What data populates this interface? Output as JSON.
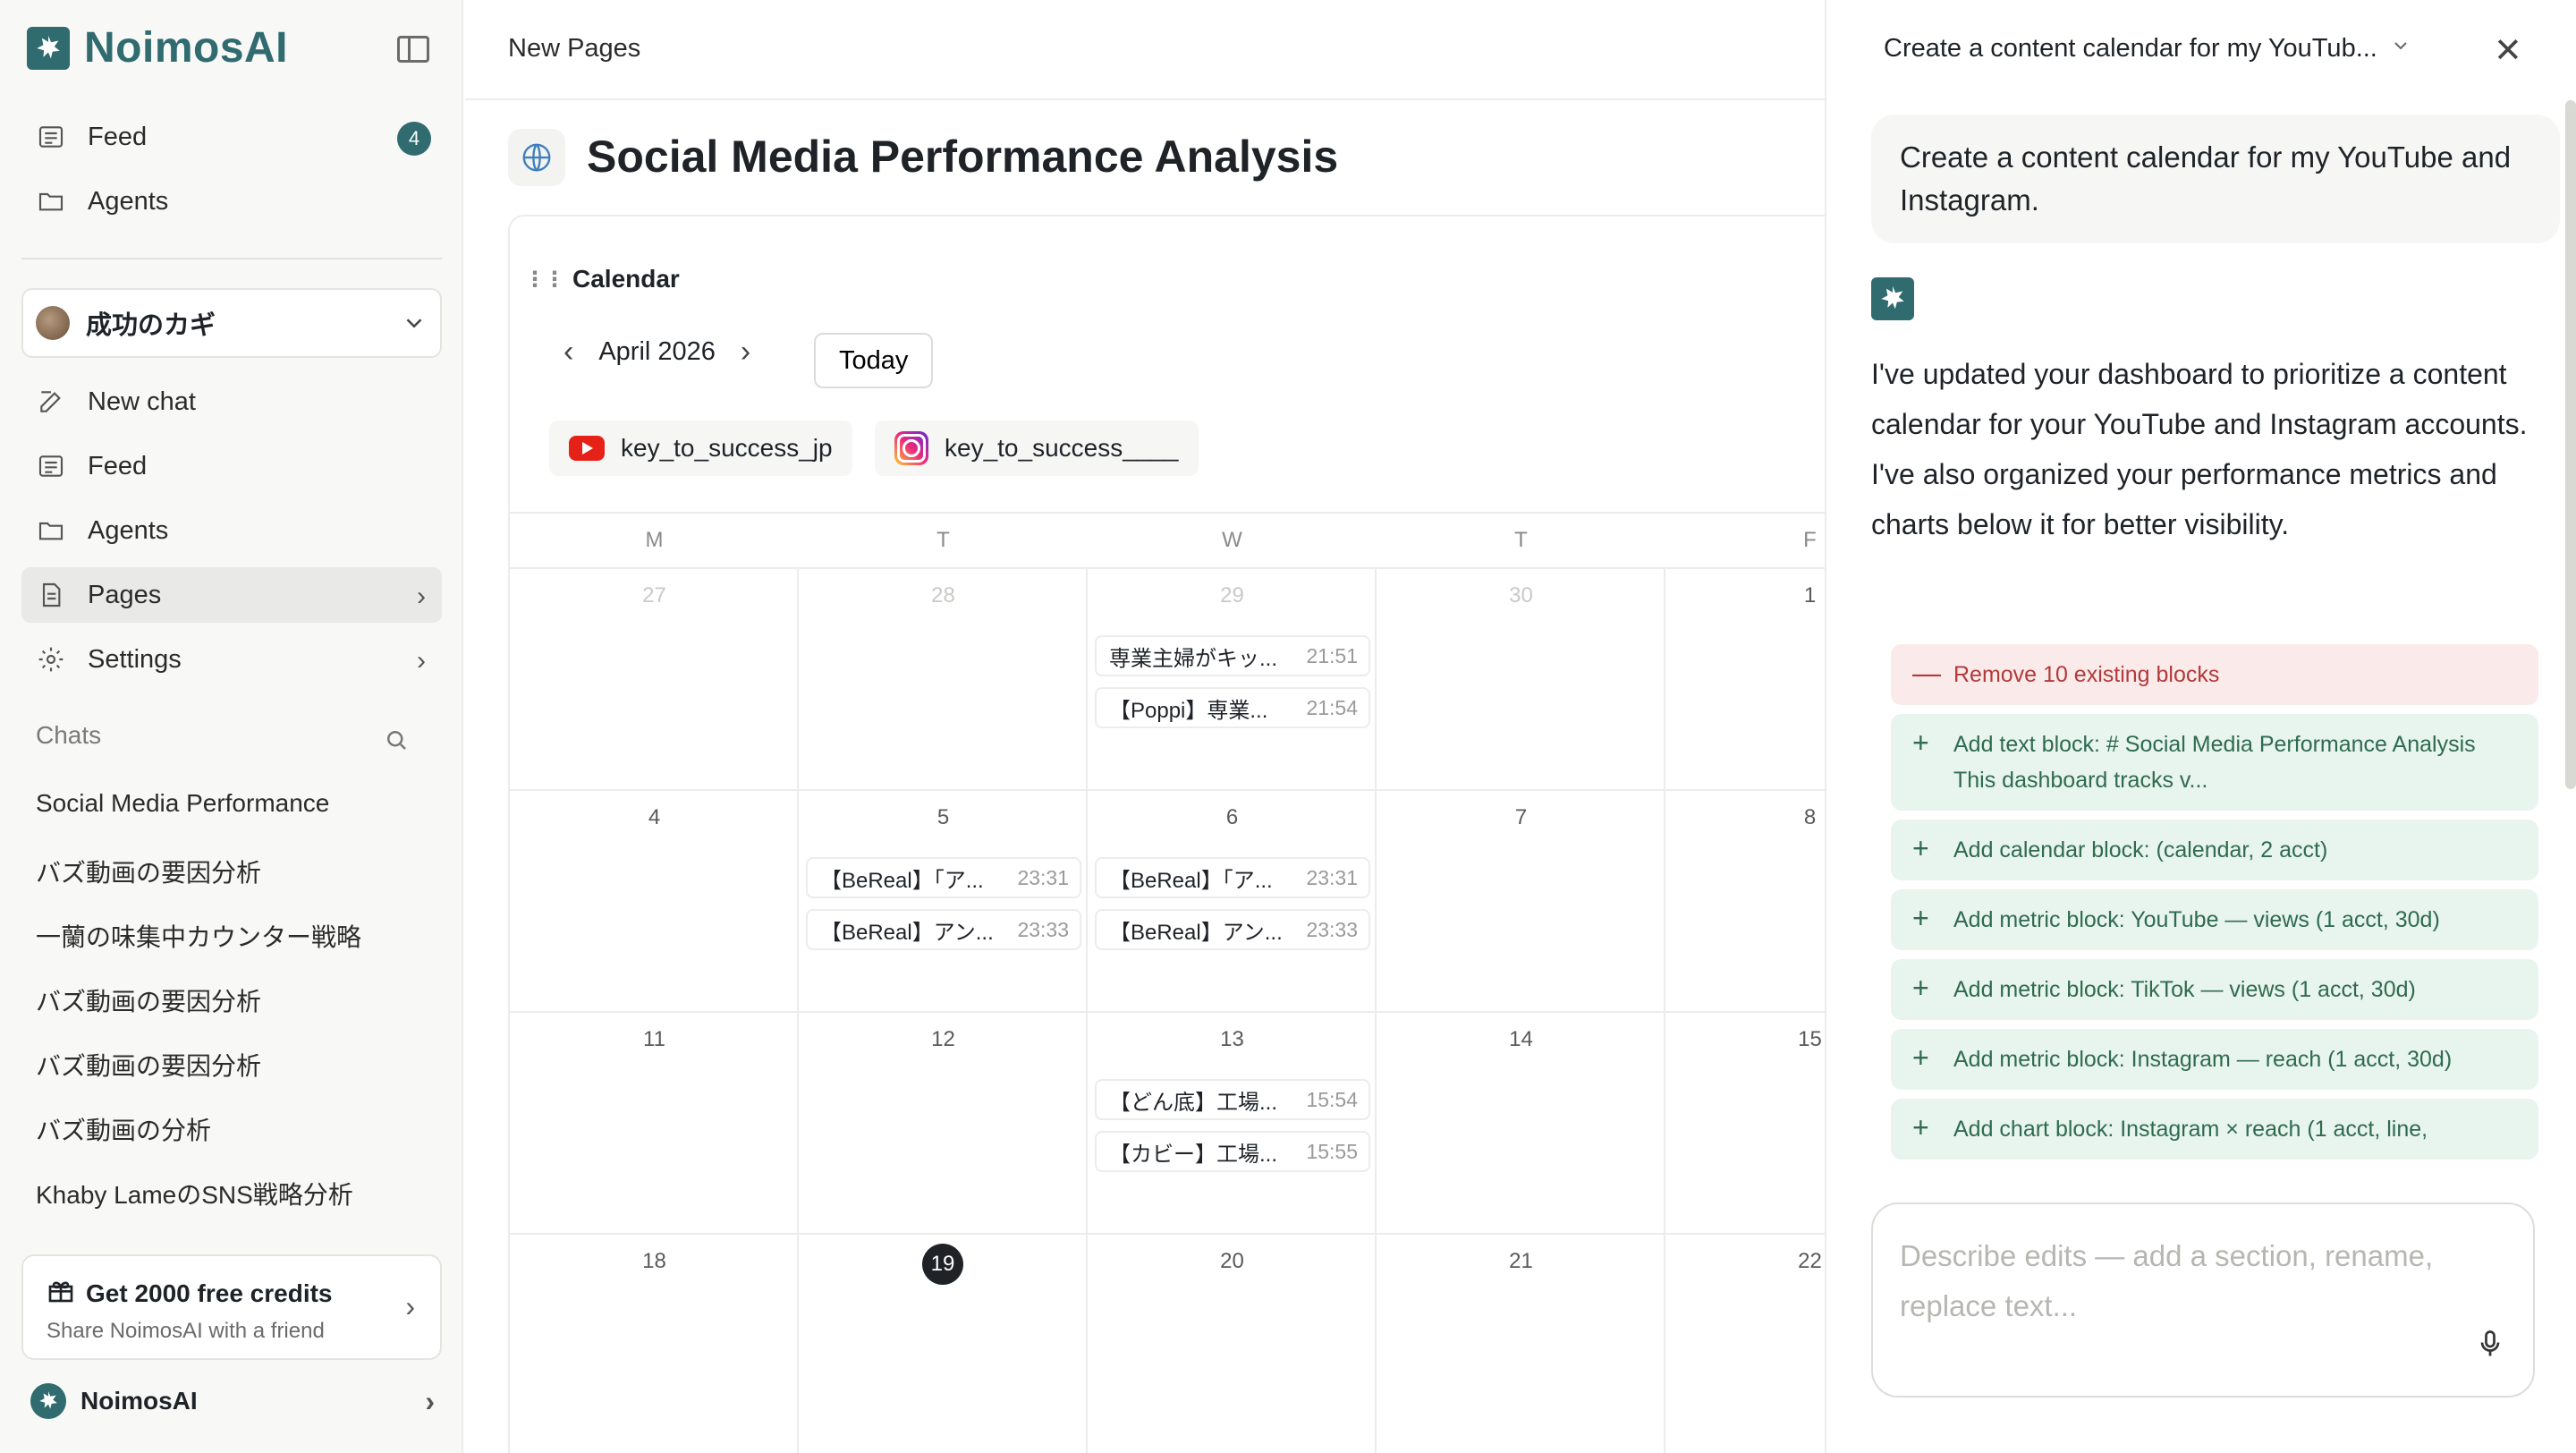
{
  "brand": {
    "name": "NoimosAI"
  },
  "sidebar": {
    "top_items": [
      {
        "label": "Feed",
        "badge": "4"
      },
      {
        "label": "Agents"
      }
    ],
    "workspace": {
      "name": "成功のカギ"
    },
    "items": [
      {
        "label": "New chat"
      },
      {
        "label": "Feed"
      },
      {
        "label": "Agents"
      },
      {
        "label": "Pages"
      },
      {
        "label": "Settings"
      }
    ],
    "chats_heading": "Chats",
    "chats": [
      "Social Media Performance",
      "バズ動画の要因分析",
      "一蘭の味集中カウンター戦略",
      "バズ動画の要因分析",
      "バズ動画の要因分析",
      "バズ動画の分析",
      "Khaby LameのSNS戦略分析"
    ],
    "promo": {
      "title": "Get 2000 free credits",
      "subtitle": "Share NoimosAI with a friend"
    },
    "account": {
      "name": "NoimosAI"
    }
  },
  "main": {
    "breadcrumb": "New Pages",
    "title": "Social Media Performance Analysis",
    "calendar": {
      "heading": "Calendar",
      "month": "April 2026",
      "today_label": "Today",
      "accounts": [
        "key_to_success_jp",
        "key_to_success____"
      ],
      "days_of_week": [
        "M",
        "T",
        "W",
        "T",
        "F"
      ],
      "weeks": [
        {
          "days": [
            "27",
            "28",
            "29",
            "30",
            "1"
          ]
        },
        {
          "days": [
            "4",
            "5",
            "6",
            "7",
            "8"
          ]
        },
        {
          "days": [
            "11",
            "12",
            "13",
            "14",
            "15"
          ]
        },
        {
          "days": [
            "18",
            "19",
            "20",
            "21",
            "22"
          ]
        }
      ],
      "events": {
        "w0_d2": [
          {
            "title": "専業主婦がキッ...",
            "time": "21:51"
          },
          {
            "title": "【Poppi】専業...",
            "time": "21:54"
          }
        ],
        "w1_d1": [
          {
            "title": "【BeReal】「ア...",
            "time": "23:31"
          },
          {
            "title": "【BeReal】アン...",
            "time": "23:33"
          }
        ],
        "w1_d2": [
          {
            "title": "【BeReal】「ア...",
            "time": "23:31"
          },
          {
            "title": "【BeReal】アン...",
            "time": "23:33"
          }
        ],
        "w2_d2": [
          {
            "title": "【どん底】工場...",
            "time": "15:54"
          },
          {
            "title": "【カビー】工場...",
            "time": "15:55"
          }
        ]
      },
      "today_day": "19"
    }
  },
  "panel": {
    "chat_title": "Create a content calendar for my YouTub...",
    "user_message": "Create a content calendar for my YouTube and Instagram.",
    "ai_message": "I've updated your dashboard to prioritize a content calendar for your YouTube and Instagram accounts. I've also organized your performance metrics and charts below it for better visibility.",
    "operations": [
      {
        "kind": "remove",
        "text": "Remove 10 existing blocks"
      },
      {
        "kind": "add",
        "text": "Add text block: # Social Media Performance Analysis This dashboard tracks v..."
      },
      {
        "kind": "add",
        "text": "Add calendar block: (calendar, 2 acct)"
      },
      {
        "kind": "add",
        "text": "Add metric block: YouTube — views (1 acct, 30d)"
      },
      {
        "kind": "add",
        "text": "Add metric block: TikTok — views (1 acct, 30d)"
      },
      {
        "kind": "add",
        "text": "Add metric block: Instagram — reach (1 acct, 30d)"
      },
      {
        "kind": "add",
        "text": "Add chart block: Instagram × reach (1 acct, line,"
      }
    ],
    "composer_placeholder": "Describe edits — add a section, rename, replace text..."
  }
}
